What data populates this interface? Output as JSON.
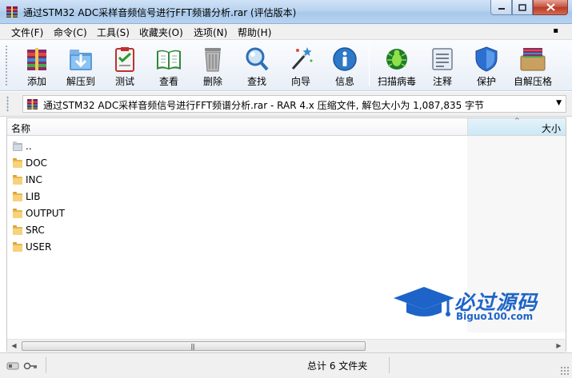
{
  "window": {
    "title": "通过STM32 ADC采样音频信号进行FFT频谱分析.rar (评估版本)"
  },
  "menu": [
    {
      "label": "文件(F)"
    },
    {
      "label": "命令(C)"
    },
    {
      "label": "工具(S)"
    },
    {
      "label": "收藏夹(O)"
    },
    {
      "label": "选项(N)"
    },
    {
      "label": "帮助(H)"
    }
  ],
  "toolbar": [
    {
      "label": "添加",
      "icon": "add-archive-icon"
    },
    {
      "label": "解压到",
      "icon": "extract-to-icon"
    },
    {
      "label": "测试",
      "icon": "test-icon"
    },
    {
      "label": "查看",
      "icon": "view-icon"
    },
    {
      "label": "删除",
      "icon": "delete-icon"
    },
    {
      "label": "查找",
      "icon": "find-icon"
    },
    {
      "label": "向导",
      "icon": "wizard-icon"
    },
    {
      "label": "信息",
      "icon": "info-icon"
    },
    {
      "label": "扫描病毒",
      "icon": "virus-scan-icon"
    },
    {
      "label": "注释",
      "icon": "comment-icon"
    },
    {
      "label": "保护",
      "icon": "protect-icon"
    },
    {
      "label": "自解压格",
      "icon": "sfx-icon"
    }
  ],
  "address": {
    "text": "通过STM32 ADC采样音频信号进行FFT频谱分析.rar - RAR 4.x 压缩文件, 解包大小为 1,087,835 字节"
  },
  "columns": {
    "name": "名称",
    "size": "大小"
  },
  "files": [
    {
      "name": "..",
      "type": "parent"
    },
    {
      "name": "DOC",
      "type": "folder"
    },
    {
      "name": "INC",
      "type": "folder"
    },
    {
      "name": "LIB",
      "type": "folder"
    },
    {
      "name": "OUTPUT",
      "type": "folder"
    },
    {
      "name": "SRC",
      "type": "folder"
    },
    {
      "name": "USER",
      "type": "folder"
    }
  ],
  "watermark": {
    "cn": "必过源码",
    "en": "Biguo100.com"
  },
  "status": {
    "text": "总计 6 文件夹"
  },
  "colors": {
    "folder": "#e8b64a",
    "selection": "#cce8f6",
    "brand": "#1e64c8"
  }
}
